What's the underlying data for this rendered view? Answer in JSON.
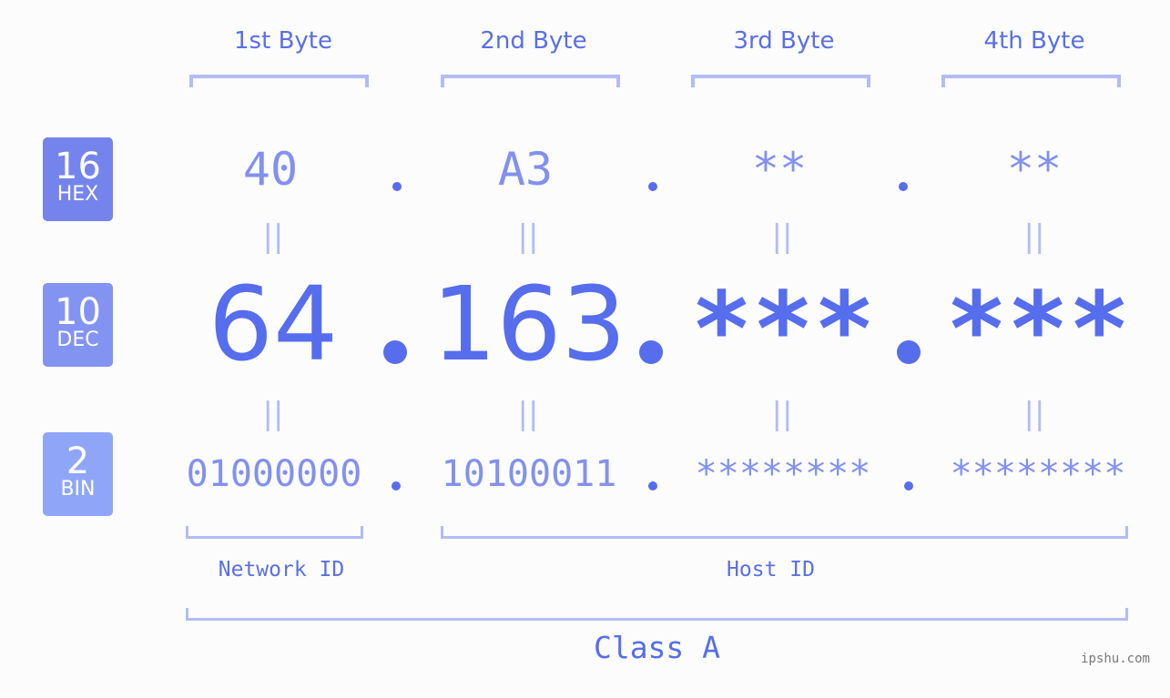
{
  "bytes": [
    {
      "header": "1st Byte",
      "hex": "40",
      "dec": "64",
      "bin": "01000000",
      "masked": false
    },
    {
      "header": "2nd Byte",
      "hex": "A3",
      "dec": "163",
      "bin": "10100011",
      "masked": false
    },
    {
      "header": "3rd Byte",
      "hex": "**",
      "dec": "***",
      "bin": "********",
      "masked": true
    },
    {
      "header": "4th Byte",
      "hex": "**",
      "dec": "***",
      "bin": "********",
      "masked": true
    }
  ],
  "bases": {
    "hex": {
      "number": "16",
      "label": "HEX",
      "color": "#7584ec"
    },
    "dec": {
      "number": "10",
      "label": "DEC",
      "color": "#8393f2"
    },
    "bin": {
      "number": "2",
      "label": "BIN",
      "color": "#8fa6f8"
    }
  },
  "equals_symbol": "||",
  "network_id_label": "Network ID",
  "host_id_label": "Host ID",
  "class_label": "Class A",
  "watermark": "ipshu.com",
  "colors": {
    "primary": "#566ded",
    "secondary": "#8290ef",
    "bracket": "#b3bcf7",
    "background": "#fbfcfb"
  }
}
